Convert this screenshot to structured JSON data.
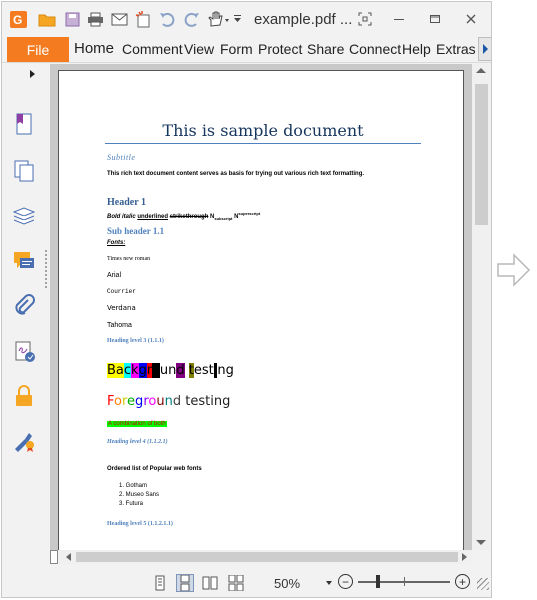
{
  "window": {
    "title": "example.pdf ...",
    "quick_access_icons": [
      "foxit-logo-icon",
      "open-folder-icon",
      "save-icon",
      "print-icon",
      "email-icon",
      "new-icon",
      "undo-icon",
      "redo-icon",
      "hand-tool-icon",
      "customize-dropdown-icon"
    ],
    "controls": [
      "fullscreen-icon",
      "minimize-icon",
      "restore-icon",
      "close-icon"
    ]
  },
  "ribbon": {
    "file_label": "File",
    "tabs": [
      "Home",
      "Comment",
      "View",
      "Form",
      "Protect",
      "Share",
      "Connect",
      "Help",
      "Extras"
    ]
  },
  "sidebar": {
    "items": [
      "bookmark-icon",
      "pages-icon",
      "layers-icon",
      "comments-icon",
      "attachments-icon",
      "signatures-icon",
      "security-icon",
      "certify-icon"
    ]
  },
  "document": {
    "title": "This is sample document",
    "subtitle": "Subtitle",
    "body": "This rich text document content serves as basis for trying out various rich text formatting.",
    "header1": "Header 1",
    "styles": {
      "bold_italic": "Bold italic",
      "underlined": "underlined",
      "strikethrough": "strikethrough",
      "n": "N",
      "subscript": "subscript",
      "superscript": "superscript"
    },
    "subheader": "Sub header 1.1",
    "fonts_label": "Fonts:",
    "fonts": [
      "Times new roman",
      "Arial",
      "Courrier",
      "Verdana",
      "Tahoma"
    ],
    "heading3": "Heading level 3 (1.1.1)",
    "background_testing": "Background testing",
    "foreground_testing": "Foreground testing",
    "combination": "A combination of both",
    "heading4": "Heading level 4 (1.1.2.1)",
    "ordered_list_title": "Ordered list of Popular web fonts",
    "ordered_list": [
      "1.   Gotham",
      "2.   Museo Sans",
      "3.   Futura"
    ],
    "heading5": "Heading level 5 (1.1.2.1.1)"
  },
  "status": {
    "view_modes": [
      "single-page-icon",
      "continuous-page-icon",
      "facing-icon",
      "continuous-facing-icon"
    ],
    "active_view": "continuous-page-icon",
    "zoom": "50%",
    "zoom_level_percent": 50
  },
  "colors": {
    "accent": "#f47b20",
    "heading_blue": "#4f81bd",
    "title_blue": "#17365d"
  }
}
